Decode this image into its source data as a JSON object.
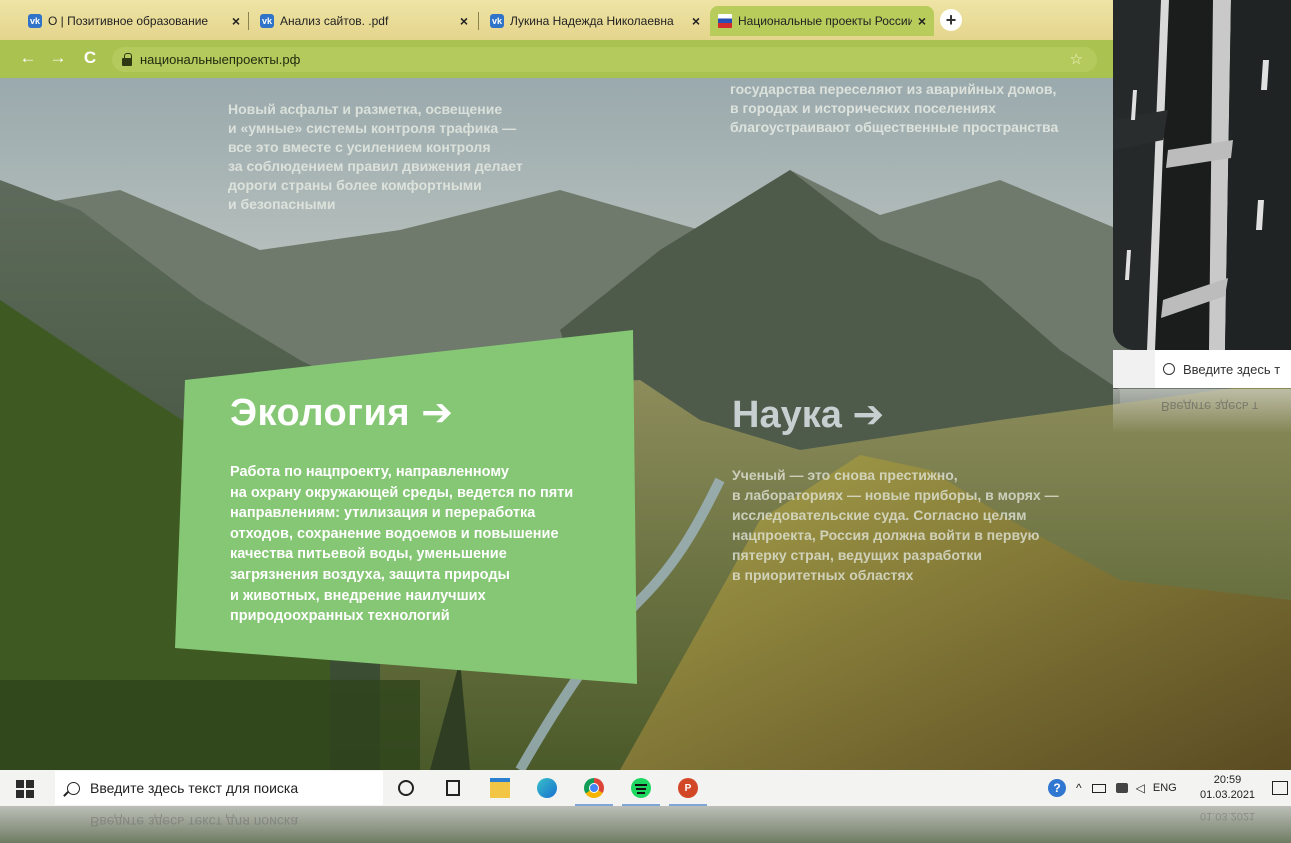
{
  "browser": {
    "tabs": [
      {
        "icon": "vk-icon",
        "title": "О | Позитивное образование"
      },
      {
        "icon": "vk-icon",
        "title": "Анализ сайтов. .pdf"
      },
      {
        "icon": "vk-icon",
        "title": "Лукина Надежда Николаевна"
      },
      {
        "icon": "russia-flag-icon",
        "title": "Национальные проекты России"
      }
    ],
    "url": "национальныепроекты.рф",
    "icons": {
      "close": "×",
      "new_tab": "+",
      "back": "←",
      "forward": "→",
      "reload": "C",
      "star": "☆"
    }
  },
  "page": {
    "roads_text": "Новый асфальт и разметка, освещение\nи «умные» системы контроля трафика —\nвсе это вместе с усилением контроля\nза соблюдением правил движения делает\nдороги страны более комфортными\nи безопасными",
    "housing_text": "государства переселяют из аварийных домов,\nв городах и исторических поселениях\nблагоустраивают общественные пространства",
    "ecology": {
      "title": "Экология ➔",
      "text": "Работа по нацпроекту, направленному\nна охрану окружающей среды, ведется по пяти\nнаправлениям: утилизация и переработка\nотходов, сохранение водоемов и повышение\nкачества питьевой воды, уменьшение\nзагрязнения воздуха, защита природы\nи животных, внедрение наилучших\nприродоохранных технологий",
      "color": "#85c774"
    },
    "science": {
      "title": "Наука ➔",
      "text": "Ученый — это снова престижно,\nв лабораториях — новые приборы, в морях —\nисследовательские суда. Согласно целям\nнацпроекта, Россия должна войти в первую\nпятерку стран, ведущих разработки\nв приоритетных областях"
    }
  },
  "inset": {
    "search_placeholder": "Введите здесь т"
  },
  "taskbar": {
    "search_placeholder": "Введите здесь текст для поиска",
    "apps": [
      "cortana-icon",
      "task-view-icon",
      "file-explorer-icon",
      "edge-icon",
      "chrome-icon",
      "spotify-icon",
      "powerpoint-icon"
    ],
    "language": "ENG",
    "time": "20:59",
    "date": "01.03.2021"
  }
}
